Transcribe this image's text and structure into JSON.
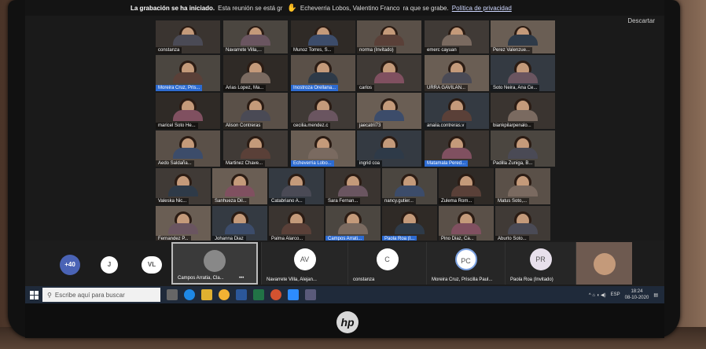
{
  "corner_badge": "",
  "recording": {
    "title": "La grabación se ha iniciado.",
    "text": "Esta reunión se está gr",
    "requester": "Echeverria Lobos, Valentino Franco",
    "text_suffix": "ra que se grabe.",
    "privacy_link": "Política de privacidad",
    "discard": "Descartar"
  },
  "grid_names": [
    "constanza",
    "Navarrete Villa,...",
    "Munoz Torres, S...",
    "norma (Invitado)",
    "emerc cayuan",
    "Perez Valenzue...",
    "Moreira Cruz, Pris...",
    "Arias Lopez, Ma...",
    "Inostroza Orellana...",
    "carlos",
    "URRA GAVILAN...",
    "Soto Neira, Ana Ce...",
    "maricel Soto He...",
    "Alison Contreras",
    "cecilia.mendez.c",
    "jaecatril73",
    "anaiia.contreras.v",
    "biankpilarpenalo...",
    "Aedo Saldaña...",
    "Martinez Chave...",
    "Echeverria Lobo...",
    "ingrid coa",
    "Matamala Pered...",
    "Padilla Zuniga, B...",
    "Valeska Nic...",
    "Sanhueza Dil...",
    "Catabriano A...",
    "Sara Fernan...",
    "nancy.gutier...",
    "Zulema Rom...",
    "Matus Soto,...",
    "Fernandez P...",
    "Johanna Diaz",
    "Palma Alarco...",
    "Campos Arrati...",
    "Paola Roa (I...",
    "Pino Diaz, Ca...",
    "Aburto Soto..."
  ],
  "strip": {
    "count_badge": "+40",
    "avatars": [
      "J",
      "VL"
    ],
    "selected_label": "Campos Arratia, Cla...",
    "more": "•••",
    "thumbs": [
      {
        "initials": "AV",
        "label": "Navarrete Villa, Alejan..."
      },
      {
        "initials": "C",
        "label": "constanza"
      },
      {
        "initials": "PC",
        "label": "Moreira Cruz, Priscilla Paul..."
      },
      {
        "initials": "PR",
        "label": "Paola Roa (Invitado)"
      }
    ]
  },
  "taskbar": {
    "search_placeholder": "Escribe aquí para buscar",
    "lang": "ESP",
    "time": "18:24",
    "date": "08-10-2020"
  },
  "brand": "hp",
  "colors": {
    "zoom_blue": "#2d6bd1",
    "taskbar": "#1f2a3a",
    "accent_hand": "#f2b233"
  }
}
